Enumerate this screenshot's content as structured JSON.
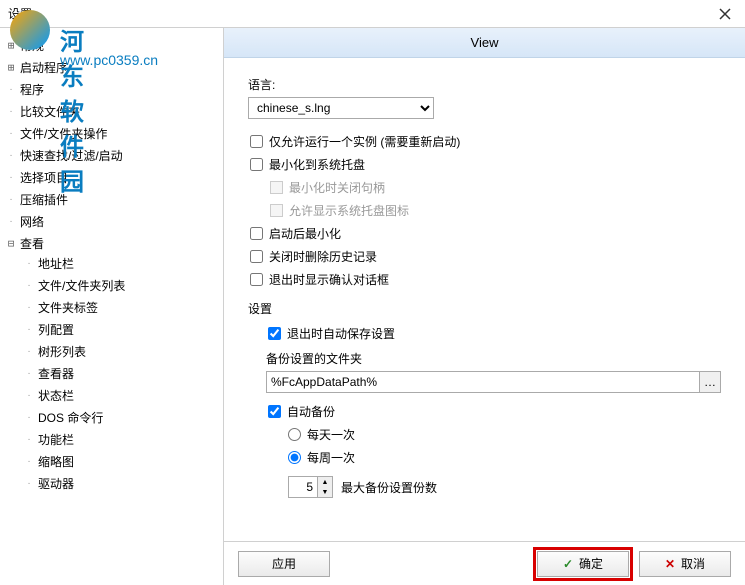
{
  "title": "设置",
  "watermark": {
    "name": "河东软件园",
    "url": "www.pc0359.cn"
  },
  "tree": [
    {
      "label": "常规",
      "expandable": true
    },
    {
      "label": "启动程序",
      "expandable": true
    },
    {
      "label": "程序"
    },
    {
      "label": "比较文件夹"
    },
    {
      "label": "文件/文件夹操作"
    },
    {
      "label": "快速查找/过滤/启动"
    },
    {
      "label": "选择项目"
    },
    {
      "label": "压缩插件"
    },
    {
      "label": "网络"
    },
    {
      "label": "查看",
      "expandable": true,
      "expanded": true,
      "children": [
        "地址栏",
        "文件/文件夹列表",
        "文件夹标签",
        "列配置",
        "树形列表",
        "查看器",
        "状态栏",
        "DOS 命令行",
        "功能栏",
        "缩略图",
        "驱动器"
      ]
    }
  ],
  "view": {
    "header": "View",
    "language_label": "语言:",
    "language_value": "chinese_s.lng",
    "opts": {
      "single_instance": "仅允许运行一个实例 (需要重新启动)",
      "min_to_tray": "最小化到系统托盘",
      "close_handle": "最小化时关闭句柄",
      "show_tray_icon": "允许显示系统托盘图标",
      "min_after_start": "启动后最小化",
      "clear_history": "关闭时删除历史记录",
      "confirm_exit": "退出时显示确认对话框"
    },
    "settings_label": "设置",
    "autosave": "退出时自动保存设置",
    "backup_folder_label": "备份设置的文件夹",
    "backup_folder_value": "%FcAppDataPath%",
    "auto_backup": "自动备份",
    "daily": "每天一次",
    "weekly": "每周一次",
    "max_backups_label": "最大备份设置份数",
    "max_backups_value": "5"
  },
  "buttons": {
    "apply": "应用",
    "ok": "确定",
    "cancel": "取消"
  }
}
